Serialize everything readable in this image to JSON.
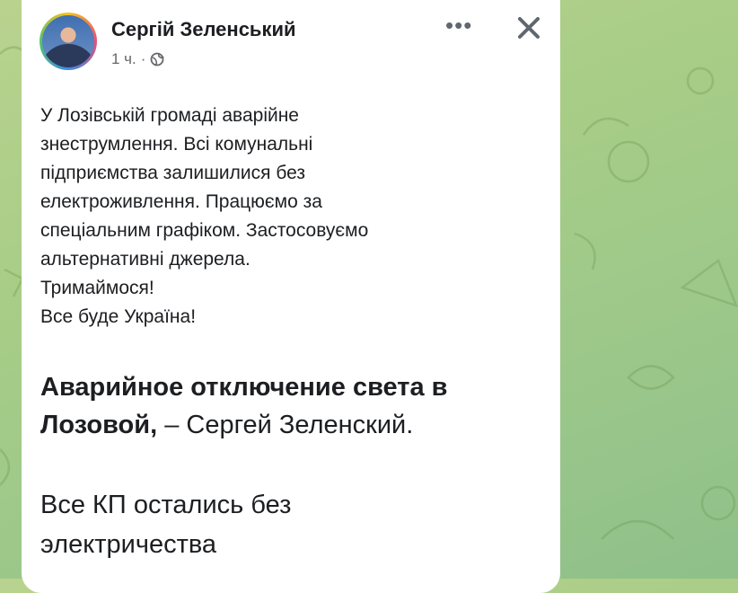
{
  "post": {
    "author": "Сергій Зеленський",
    "time": "1 ч.",
    "separator": "·",
    "privacy_icon": "globe-icon",
    "more_label": "•••",
    "close_icon": "close-icon",
    "body_lines": [
      "У Лозівській громаді аварійне",
      "знеструмлення. Всі комунальні",
      "підприємства залишилися без",
      "електроживлення. Працюємо за",
      "спеціальним графіком. Застосовуємо",
      "альтернативні джерела.",
      "Тримаймося!",
      "Все буде Україна!"
    ],
    "headline_bold_1": "Аварийное отключение света в",
    "headline_bold_2": "Лозовой,",
    "headline_rest": " – Сергей Зеленский.",
    "subtext_line1": "Все КП остались без",
    "subtext_line2": "электричества"
  },
  "colors": {
    "background": "#a8cd86",
    "card": "#ffffff",
    "text": "#1c1e21",
    "meta": "#65676b"
  }
}
